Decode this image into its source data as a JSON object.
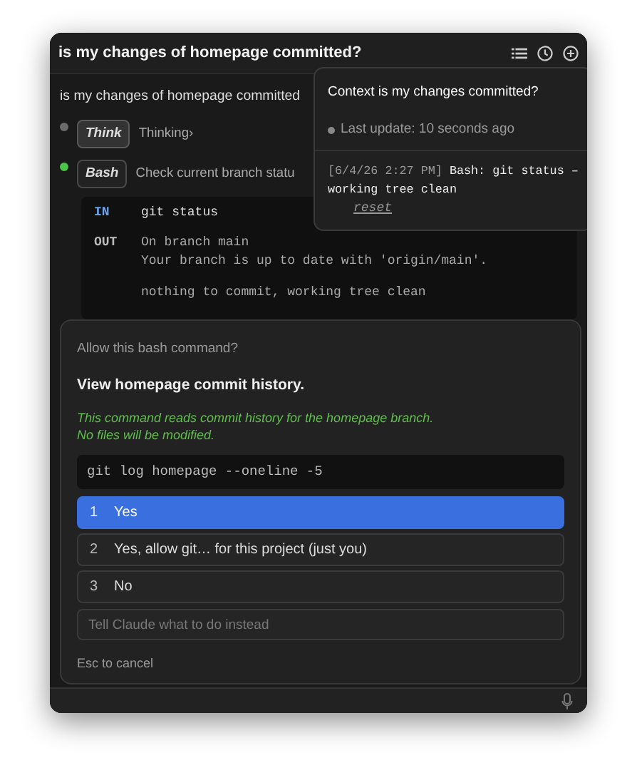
{
  "window": {
    "title": "is my changes of homepage committed?"
  },
  "chat": {
    "user_message": "is my changes of homepage committed",
    "steps": [
      {
        "kind": "think",
        "color": "#6b6b6b",
        "badge": "Think",
        "text": "Thinking›"
      },
      {
        "kind": "tool",
        "color": "#4cc44c",
        "badge": "Bash",
        "text": "Check current branch statu"
      }
    ],
    "code": {
      "in_label": "IN",
      "input": "git status",
      "out_label": "OUT",
      "output_blocks": [
        [
          "On branch main",
          "Your branch is up to date with 'origin/main'."
        ],
        [
          "nothing to commit, working tree clean"
        ]
      ]
    }
  },
  "context_popover": {
    "title": "Context is my changes committed?",
    "status": "Last update: 10 seconds ago",
    "log": [
      {
        "time": "[6/4/26 2:27 PM]",
        "text": "Bash: git status – working tree clean"
      }
    ],
    "link": "reset"
  },
  "dialog": {
    "prompt": "Allow this bash command?",
    "title": "View homepage commit history.",
    "description": [
      "This command reads commit history for the homepage branch.",
      "No files will be modified."
    ],
    "command": "git log homepage --oneline -5",
    "options": [
      {
        "number": "1",
        "label": "Yes",
        "selected": true
      },
      {
        "number": "2",
        "label": "Yes, allow git… for this project (just you)",
        "selected": false
      },
      {
        "number": "3",
        "label": "No",
        "selected": false
      }
    ],
    "feedback": {
      "placeholder": "Tell Claude what to do instead"
    },
    "hint": "Esc to cancel"
  }
}
